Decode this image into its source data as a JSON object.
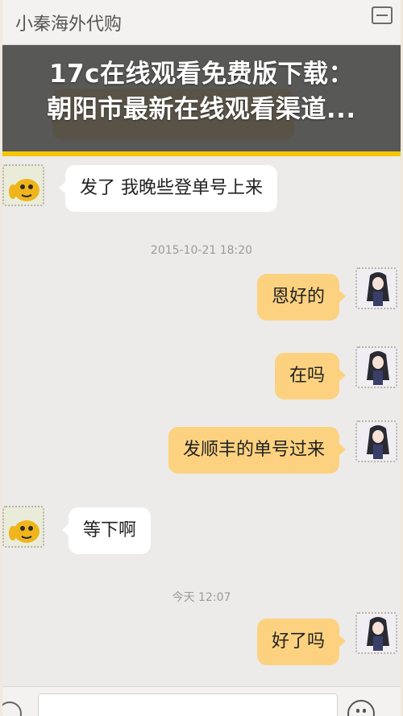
{
  "app": {
    "title": "小秦海外代购"
  },
  "overlay": {
    "line1": "17c在线观看免费版下载：",
    "line2": "朝阳市最新在线观看渠道..."
  },
  "messages": [
    {
      "side": "in",
      "text": "发了 我晚些登单号上来"
    },
    {
      "timestamp": "2015-10-21 18:20"
    },
    {
      "side": "out",
      "text": "恩好的"
    },
    {
      "side": "out",
      "text": "在吗"
    },
    {
      "side": "out",
      "text": "发顺丰的单号过来"
    },
    {
      "side": "in",
      "text": "等下啊"
    },
    {
      "timestamp": "今天 12:07"
    },
    {
      "side": "out",
      "text": "好了吗"
    }
  ],
  "colors": {
    "overlay": "#373737",
    "outgoing_bubble": "#fcd280",
    "incoming_bubble": "#ffffff",
    "accent_bar": "#f7c500"
  },
  "icons": [
    "back-icon",
    "menu-icon",
    "voice-icon",
    "emoji-icon",
    "plus-icon"
  ]
}
